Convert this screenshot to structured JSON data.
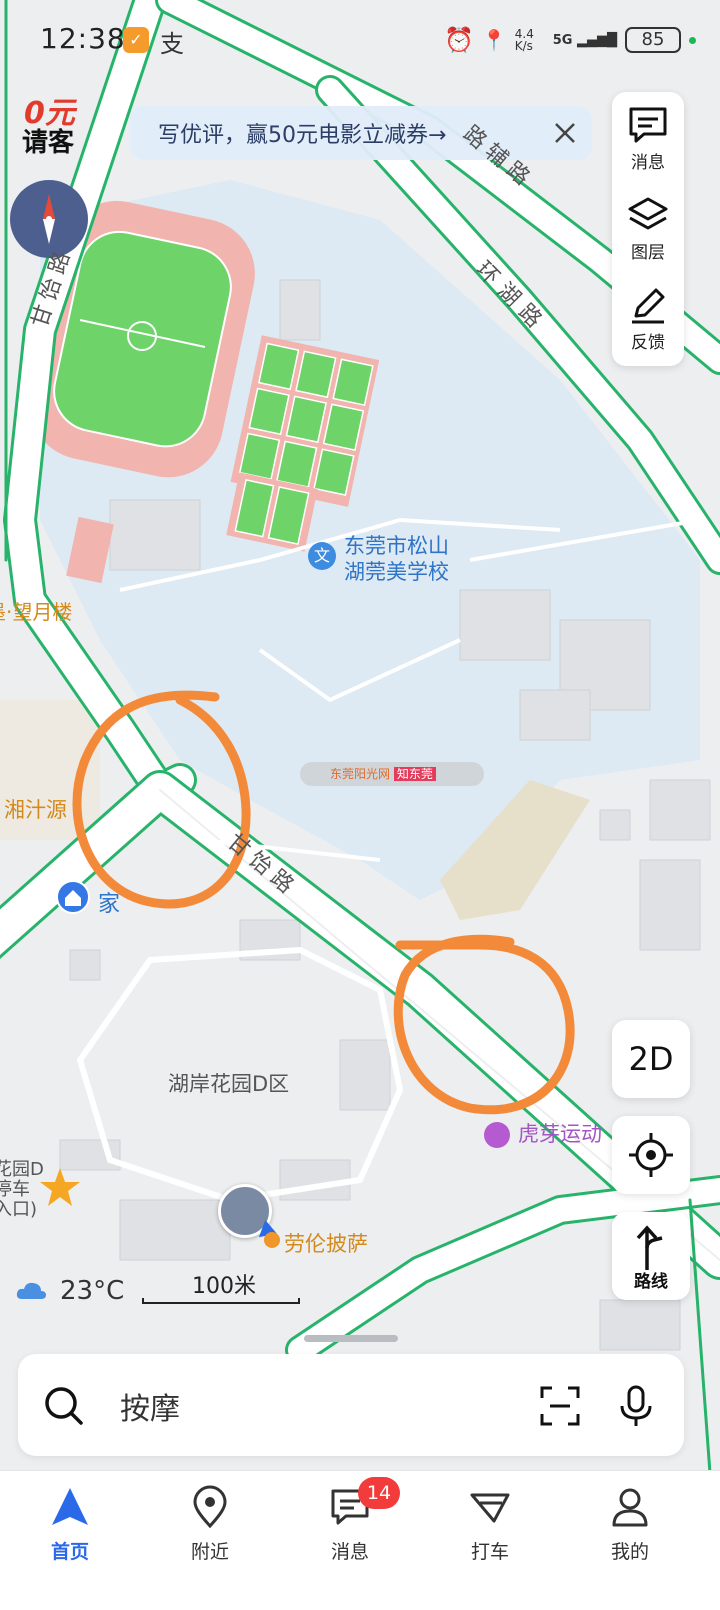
{
  "status_bar": {
    "time": "12:38",
    "app_icon_glyph": "支",
    "network_speed": "4.4 K/s",
    "signal": "5G",
    "battery": "85"
  },
  "promo": {
    "line1": "0元",
    "line2": "请客"
  },
  "banner": {
    "text": "写优评，赢50元电影立减券→"
  },
  "right_panel": {
    "items": [
      {
        "label": "消息",
        "icon": "message-icon"
      },
      {
        "label": "图层",
        "icon": "layers-icon"
      },
      {
        "label": "反馈",
        "icon": "feedback-pen-icon"
      }
    ]
  },
  "map_labels": {
    "road_top_right": "路辅路",
    "road_huanhu": "环湖路",
    "road_left": "甘饴路",
    "road_center": "甘饴路",
    "school_line1": "东莞市松山",
    "school_line2": "湖莞美学校",
    "school_icon_glyph": "文",
    "place_wangyue": "墨·望月楼",
    "place_xiangzhi": "湘汁源",
    "home": "家",
    "huan_garden": "湖岸花园D区",
    "hu_ya": "虎芽运动",
    "lao_lun": "劳伦披萨",
    "parking_line1": "花园D",
    "parking_line2": "停车",
    "parking_line3": "入口)",
    "ad_text1": "东莞阳光网",
    "ad_text2": "知东莞"
  },
  "controls": {
    "view_mode": "2D",
    "route_label": "路线"
  },
  "weather": {
    "temperature": "23°C"
  },
  "scale": {
    "label": "100米"
  },
  "search": {
    "value": "按摩"
  },
  "tabs": [
    {
      "label": "首页",
      "icon": "navigation-arrow-icon",
      "active": true
    },
    {
      "label": "附近",
      "icon": "location-pin-icon",
      "active": false
    },
    {
      "label": "消息",
      "icon": "message-icon",
      "active": false,
      "badge": "14"
    },
    {
      "label": "打车",
      "icon": "taxi-flag-icon",
      "active": false
    },
    {
      "label": "我的",
      "icon": "user-icon",
      "active": false
    }
  ],
  "colors": {
    "accent": "#2a6ae9",
    "road_stroke": "#27b36a",
    "annotation": "#f28a3a",
    "badge": "#f23b3b"
  }
}
